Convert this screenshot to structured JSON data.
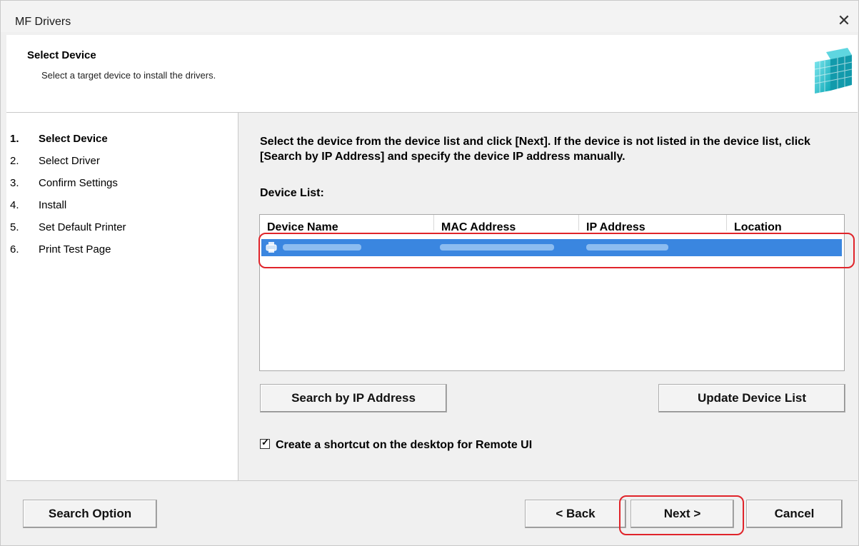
{
  "window": {
    "title": "MF Drivers",
    "close_glyph": "✕"
  },
  "header": {
    "title": "Select Device",
    "subtitle": "Select a target device to install the drivers.",
    "logo_icon": "installer-cube-icon"
  },
  "steps": [
    {
      "num": "1.",
      "label": "Select Device",
      "active": true
    },
    {
      "num": "2.",
      "label": "Select Driver",
      "active": false
    },
    {
      "num": "3.",
      "label": "Confirm Settings",
      "active": false
    },
    {
      "num": "4.",
      "label": "Install",
      "active": false
    },
    {
      "num": "5.",
      "label": "Set Default Printer",
      "active": false
    },
    {
      "num": "6.",
      "label": "Print Test Page",
      "active": false
    }
  ],
  "main": {
    "instructions": "Select the device from the device list and click [Next]. If the device is not listed in the device list, click [Search by IP Address] and specify the device IP address manually.",
    "device_list_label": "Device List:",
    "columns": [
      "Device Name",
      "MAC Address",
      "IP Address",
      "Location"
    ],
    "selected_row_note": "row contents blurred",
    "search_ip_button": "Search by IP Address",
    "update_list_button": "Update Device List",
    "shortcut_checkbox": {
      "label": "Create a shortcut on the desktop for Remote UI",
      "checked": true,
      "mark": "✓"
    }
  },
  "footer": {
    "search_option_button": "Search Option",
    "back_button": "< Back",
    "next_button": "Next >",
    "cancel_button": "Cancel"
  },
  "colors": {
    "selection": "#3a86e0",
    "highlight_outline": "#e0242a"
  }
}
